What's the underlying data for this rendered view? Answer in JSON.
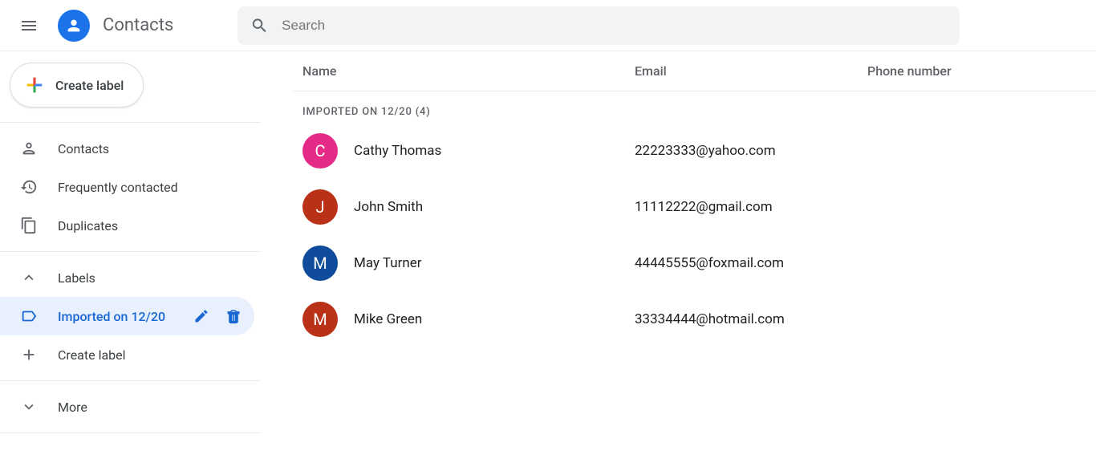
{
  "header": {
    "app_title": "Contacts",
    "search_placeholder": "Search"
  },
  "sidebar": {
    "create_label": "Create label",
    "nav": {
      "contacts": "Contacts",
      "frequent": "Frequently contacted",
      "duplicates": "Duplicates"
    },
    "labels_heading": "Labels",
    "label_imported": "Imported on 12/20",
    "more": "More"
  },
  "table": {
    "col_name": "Name",
    "col_email": "Email",
    "col_phone": "Phone number",
    "group_heading": "Imported on 12/20 (4)"
  },
  "contacts": [
    {
      "initial": "C",
      "name": "Cathy Thomas",
      "email": "22223333@yahoo.com",
      "phone": "",
      "color": "#e52b87"
    },
    {
      "initial": "J",
      "name": "John Smith",
      "email": "11112222@gmail.com",
      "phone": "",
      "color": "#b93218"
    },
    {
      "initial": "M",
      "name": "May Turner",
      "email": "44445555@foxmail.com",
      "phone": "",
      "color": "#0f4c9c"
    },
    {
      "initial": "M",
      "name": "Mike Green",
      "email": "33334444@hotmail.com",
      "phone": "",
      "color": "#b93218"
    }
  ]
}
